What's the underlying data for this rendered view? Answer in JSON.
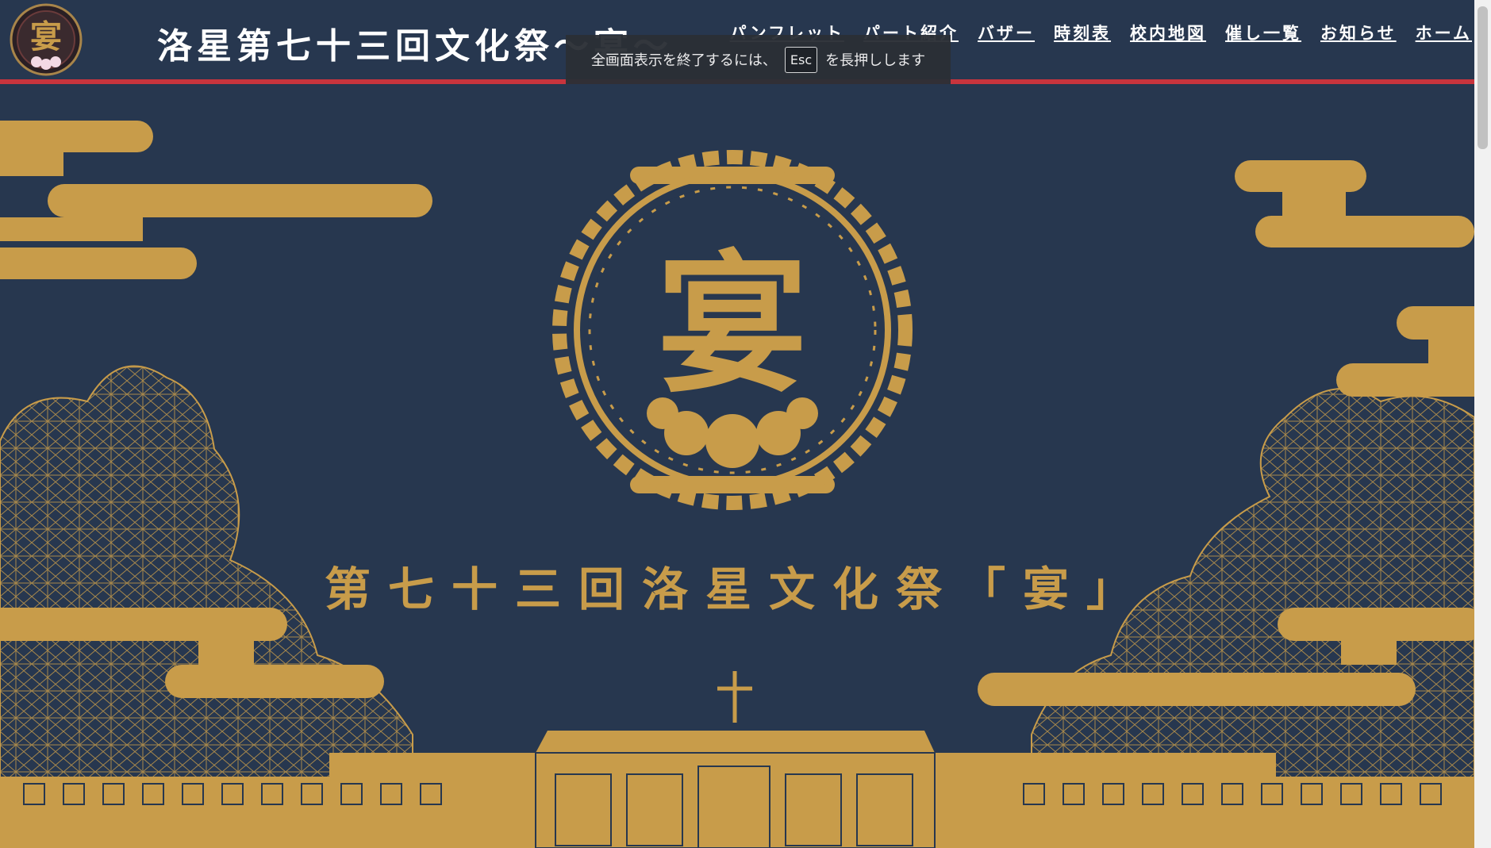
{
  "header": {
    "logo_char": "宴",
    "title": "洛星第七十三回文化祭〜宴〜"
  },
  "nav": {
    "items": [
      {
        "label": "パンフレット"
      },
      {
        "label": "パート紹介"
      },
      {
        "label": "バザー"
      },
      {
        "label": "時刻表"
      },
      {
        "label": "校内地図"
      },
      {
        "label": "催し一覧"
      },
      {
        "label": "お知らせ"
      },
      {
        "label": "ホーム"
      }
    ]
  },
  "toast": {
    "before": "全画面表示を終了するには、",
    "key": "Esc",
    "after": "を長押しします"
  },
  "hero": {
    "emblem_char": "宴",
    "title": "第七十三回洛星文化祭「宴」"
  },
  "colors": {
    "background": "#27374f",
    "gold": "#c89c4a",
    "accent_red": "#c8343d",
    "text": "#ffffff"
  }
}
